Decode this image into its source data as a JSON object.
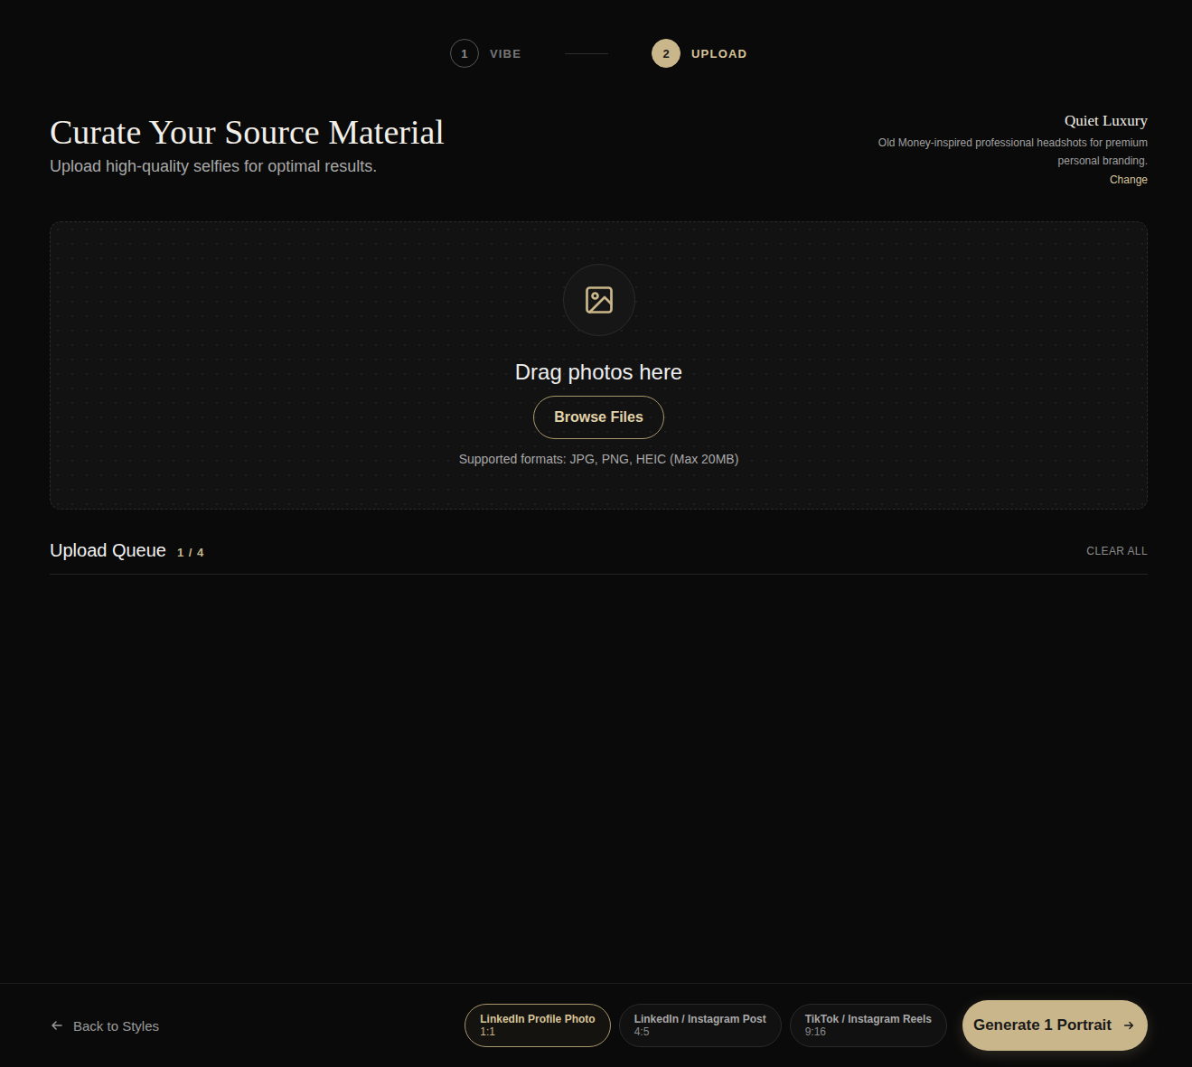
{
  "stepper": [
    {
      "number": "1",
      "label": "VIBE",
      "selected": false
    },
    {
      "number": "2",
      "label": "UPLOAD",
      "selected": true
    }
  ],
  "header": {
    "title": "Curate Your Source Material",
    "subtitle": "Upload high-quality selfies for optimal results."
  },
  "style": {
    "name": "Quiet Luxury",
    "description": "Old Money-inspired professional headshots for premium personal branding.",
    "change": "Change"
  },
  "dropzone": {
    "title": "Drag photos here",
    "button": "Browse Files",
    "formats": "Supported formats: JPG, PNG, HEIC (Max 20MB)"
  },
  "queue": {
    "title": "Upload Queue",
    "count": "1 / 4",
    "clear": "CLEAR ALL",
    "items": [
      {
        "kind": "photo",
        "removable": true
      }
    ]
  },
  "footer": {
    "back": "Back to Styles",
    "formats": [
      {
        "label": "LinkedIn Profile Photo",
        "ratio": "1:1",
        "selected": true
      },
      {
        "label": "LinkedIn / Instagram Post",
        "ratio": "4:5",
        "selected": false
      },
      {
        "label": "TikTok / Instagram Reels",
        "ratio": "9:16",
        "selected": false
      }
    ],
    "generate": "Generate 1 Portrait"
  }
}
